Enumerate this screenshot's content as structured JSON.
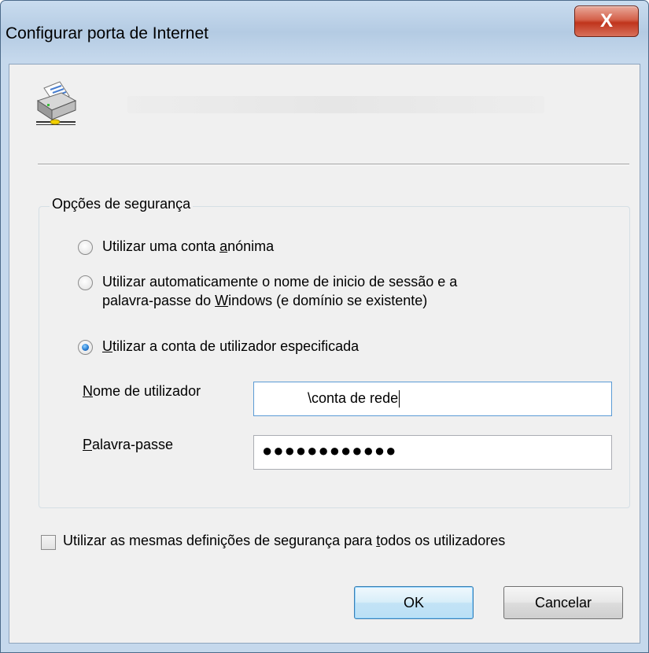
{
  "window": {
    "title": "Configurar porta de Internet",
    "close_label": "X"
  },
  "security": {
    "legend": "Opções de segurança",
    "options": [
      {
        "pre": "Utilizar uma conta ",
        "key": "a",
        "post": "nónima",
        "checked": false
      },
      {
        "line1": "Utilizar automaticamente o nome de inicio de sessão e a",
        "line2_pre": "palavra-passe do ",
        "line2_key": "W",
        "line2_post": "indows (e domínio se existente)",
        "checked": false
      },
      {
        "key": "U",
        "post": "tilizar a conta de utilizador especificada",
        "checked": true
      }
    ],
    "username_label_key": "N",
    "username_label_rest": "ome de utilizador",
    "username_value": "\\conta de rede",
    "password_label_key": "P",
    "password_label_rest": "alavra-passe",
    "password_value": "●●●●●●●●●●●●"
  },
  "same_settings": {
    "pre": "Utilizar as mesmas definições de segurança para ",
    "key": "t",
    "post": "odos os utilizadores",
    "checked": false
  },
  "buttons": {
    "ok": "OK",
    "cancel": "Cancelar"
  },
  "colors": {
    "accent": "#2a7fd4",
    "close": "#c0341c",
    "dialog_bg": "#f0f0f0"
  }
}
